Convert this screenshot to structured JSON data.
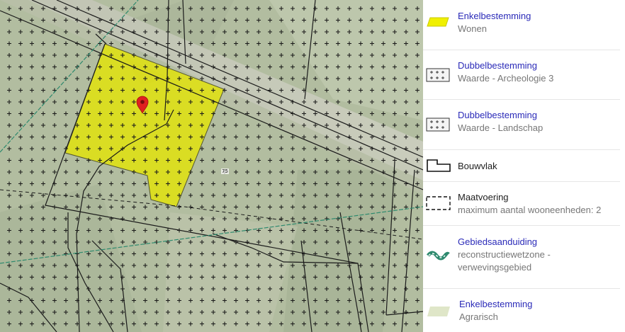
{
  "map": {
    "marker": "location-pin-icon",
    "parcel_label": "75",
    "colors": {
      "wonen_fill": "#e6e600",
      "agrarisch_fill": "#dfe6c8",
      "archeologie_cross": "#1a1a1a",
      "gebied_line": "#2e8a6e",
      "marker": "#e02020"
    }
  },
  "legend": {
    "items": [
      {
        "title": "Enkelbestemming",
        "subtitle": "Wonen",
        "symbol": "yellow-fill-icon"
      },
      {
        "title": "Dubbelbestemming",
        "subtitle": "Waarde - Archeologie 3",
        "symbol": "cross-hatch-icon"
      },
      {
        "title": "Dubbelbestemming",
        "subtitle": "Waarde - Landschap",
        "symbol": "cross-hatch-icon"
      },
      {
        "title": "Bouwvlak",
        "symbol": "bouwvlak-icon"
      },
      {
        "title": "Maatvoering",
        "subtitle": "maximum aantal wooneenheden: 2",
        "symbol": "dashed-rect-icon"
      },
      {
        "title": "Gebiedsaanduiding",
        "subtitle": "reconstructiewetzone -",
        "subtitle2": "verwevingsgebied",
        "symbol": "green-chain-icon"
      },
      {
        "title": "Enkelbestemming",
        "subtitle": "Agrarisch",
        "symbol": "agrarisch-fill-icon"
      }
    ]
  }
}
